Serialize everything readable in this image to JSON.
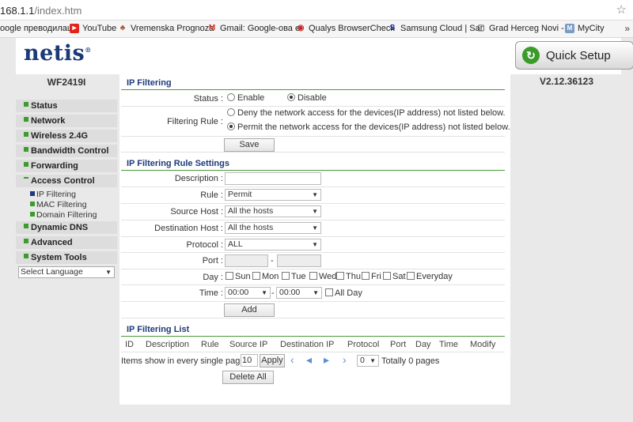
{
  "browser": {
    "url_prefix": "168.1.1",
    "url_path": "/index.htm",
    "bookmarks": [
      {
        "label": "oogle преводилац",
        "icon": "google-icon"
      },
      {
        "label": "YouTube",
        "icon": "youtube-icon"
      },
      {
        "label": "Vremenska Prognoza",
        "icon": "weather-icon"
      },
      {
        "label": "Gmail: Google-ова е",
        "icon": "gmail-icon"
      },
      {
        "label": "Qualys BrowserCheck",
        "icon": "qualys-icon"
      },
      {
        "label": "Samsung Cloud | Sar",
        "icon": "samsung-icon"
      },
      {
        "label": "Grad Herceg Novi - V",
        "icon": "page-icon"
      },
      {
        "label": "MyCity",
        "icon": "mycity-icon"
      }
    ],
    "more": "»"
  },
  "header": {
    "logo": "netis",
    "logo_mark": "®",
    "quick_setup": "Quick Setup"
  },
  "sidebar": {
    "model": "WF2419I",
    "items": [
      "Status",
      "Network",
      "Wireless 2.4G",
      "Bandwidth Control",
      "Forwarding",
      "Access Control"
    ],
    "sub_items": [
      "IP Filtering",
      "MAC Filtering",
      "Domain Filtering"
    ],
    "items_after": [
      "Dynamic DNS",
      "Advanced",
      "System Tools"
    ],
    "language": "Select Language"
  },
  "version": "V2.12.36123",
  "ip_filtering": {
    "title": "IP Filtering",
    "status_label": "Status :",
    "status_enable": "Enable",
    "status_disable": "Disable",
    "rule_label": "Filtering Rule :",
    "rule_deny": "Deny the network access for the devices(IP address) not listed below.",
    "rule_permit": "Permit the network access for the devices(IP address) not listed below.",
    "save": "Save"
  },
  "rule_settings": {
    "title": "IP Filtering Rule Settings",
    "description_label": "Description :",
    "rule_label": "Rule :",
    "rule_value": "Permit",
    "source_label": "Source Host :",
    "source_value": "All the hosts",
    "dest_label": "Destination Host :",
    "dest_value": "All the hosts",
    "protocol_label": "Protocol :",
    "protocol_value": "ALL",
    "port_label": "Port :",
    "port_sep": "-",
    "day_label": "Day :",
    "days": [
      "Sun",
      "Mon",
      "Tue",
      "Wed",
      "Thu",
      "Fri",
      "Sat",
      "Everyday"
    ],
    "time_label": "Time :",
    "time_from": "00:00",
    "time_to": "00:00",
    "time_sep": "-",
    "all_day": "All Day",
    "add": "Add"
  },
  "list": {
    "title": "IP Filtering List",
    "columns": [
      "ID",
      "Description",
      "Rule",
      "Source IP",
      "Destination IP",
      "Protocol",
      "Port",
      "Day",
      "Time",
      "Modify"
    ],
    "items_label": "Items show in every single page",
    "page_size": "10",
    "apply": "Apply",
    "page_select": "0",
    "total": "Totally 0 pages",
    "delete_all": "Delete All"
  },
  "colors": {
    "accent_green": "#4a9a3a",
    "title_blue": "#1e3a7a",
    "brand_blue": "#1b3a78"
  }
}
